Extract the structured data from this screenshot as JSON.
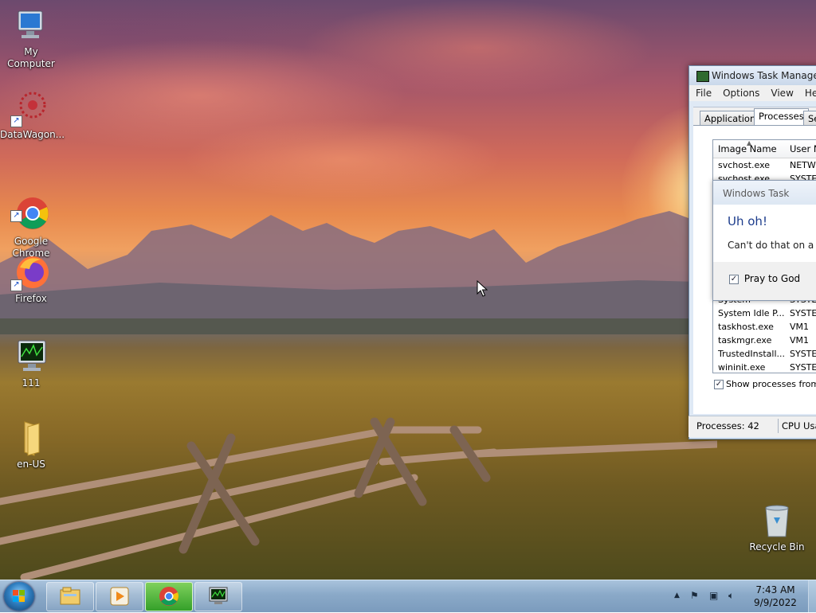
{
  "desktop": {
    "icons": [
      {
        "label": "My Computer",
        "icon": "my-computer-icon"
      },
      {
        "label": "DataWagon...",
        "icon": "datawagon-icon"
      },
      {
        "label": "Google\nChrome",
        "icon": "chrome-icon"
      },
      {
        "label": "Firefox",
        "icon": "firefox-icon"
      },
      {
        "label": "111",
        "icon": "monitor-app-icon"
      },
      {
        "label": "en-US",
        "icon": "folder-icon"
      },
      {
        "label": "Recycle Bin",
        "icon": "recycle-bin-icon"
      }
    ]
  },
  "task_manager": {
    "title": "Windows Task Manager",
    "menu": [
      "File",
      "Options",
      "View",
      "Hel"
    ],
    "tabs": [
      "Applications",
      "Processes",
      "Se"
    ],
    "columns": [
      "Image Name",
      "User N"
    ],
    "rows_top": [
      {
        "name": "svchost.exe",
        "user": "NETWO"
      },
      {
        "name": "svchost.exe",
        "user": "SYSTE"
      }
    ],
    "rows_bottom": [
      {
        "name": "System",
        "user": "SYSTE"
      },
      {
        "name": "System Idle P...",
        "user": "SYSTE"
      },
      {
        "name": "taskhost.exe",
        "user": "VM1"
      },
      {
        "name": "taskmgr.exe",
        "user": "VM1"
      },
      {
        "name": "TrustedInstall...",
        "user": "SYSTE"
      },
      {
        "name": "wininit.exe",
        "user": "SYSTE"
      }
    ],
    "show_all_label": "Show processes from al",
    "show_all_checked": true,
    "status_processes": "Processes: 42",
    "status_cpu": "CPU Usa"
  },
  "dialog": {
    "title": "Windows Task Manage",
    "heading": "Uh oh!",
    "message": "Can't do that on a Ch",
    "checkbox_label": "Pray to God",
    "checkbox_checked": true
  },
  "taskbar": {
    "pinned": [
      "explorer-icon",
      "media-player-icon",
      "chrome-icon",
      "task-manager-icon"
    ],
    "time": "7:43 AM",
    "date": "9/9/2022"
  },
  "colors": {
    "taskbar": "#8aa9c8",
    "dialog_heading": "#1c3c8c",
    "active_taskbar_button": "#34a02a"
  }
}
